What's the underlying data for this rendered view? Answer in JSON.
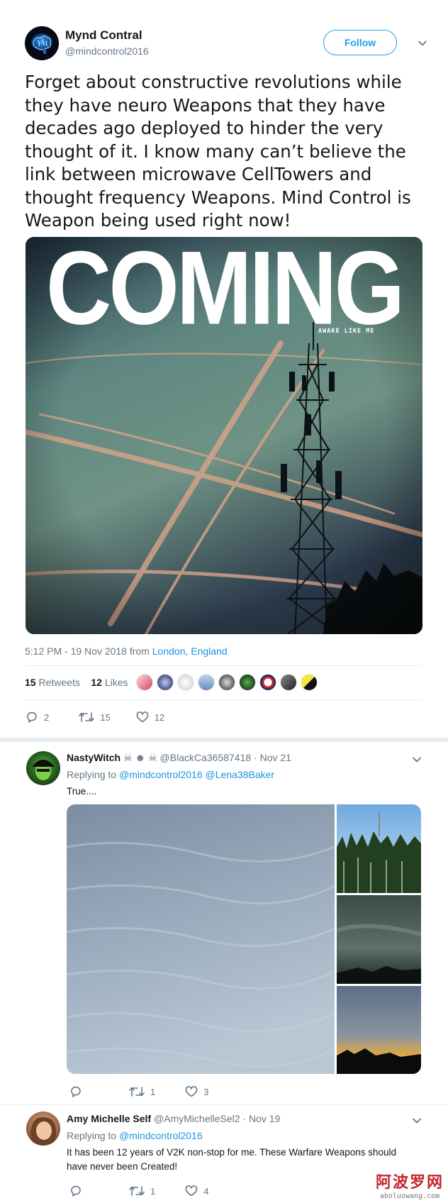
{
  "tweet": {
    "author_name": "Mynd Contral",
    "author_handle": "@mindcontrol2016",
    "follow_label": "Follow",
    "text": "Forget about constructive revolutions while they have neuro Weapons that they have decades ago deployed to hinder the very thought of it. I know many can’t believe the link between microwave CellTowers and thought frequency Weapons. Mind Control is Weapon being used right now!",
    "image_title": "COMING",
    "image_caption": "AWAKE LIKE ME",
    "time": "5:12 PM - 19 Nov 2018 from",
    "location": "London, England",
    "retweets_count": "15",
    "retweets_label": "Retweets",
    "likes_count": "12",
    "likes_label": "Likes",
    "reply_count": "2",
    "retweet_count_action": "15",
    "like_count_action": "12"
  },
  "replies": [
    {
      "name": "NastyWitch",
      "emojis": "☠ ☻ ☠",
      "handle": "@BlackCa36587418",
      "date": "· Nov 21",
      "replying_to_label": "Replying to",
      "replying_to": "@mindcontrol2016 @Lena38Baker",
      "text": "True....",
      "reply_count": "",
      "retweet_count": "1",
      "like_count": "3"
    },
    {
      "name": "Amy Michelle Self",
      "handle": "@AmyMichelleSel2",
      "date": "· Nov 19",
      "replying_to_label": "Replying to",
      "replying_to": "@mindcontrol2016",
      "text": "It has been 12 years of V2K non-stop for me. These Warfare Weapons should have never been Created!",
      "reply_count": "",
      "retweet_count": "1",
      "like_count": "4"
    }
  ],
  "watermark": {
    "cn": "阿波罗网",
    "en": "aboluowang.com"
  },
  "colors": {
    "accent": "#1da1f2",
    "link": "#1b95e0",
    "muted": "#657786",
    "text": "#14171a",
    "divider": "#e6ecf0"
  },
  "icons": [
    "brain-icon",
    "chevron-down-icon",
    "reply-icon",
    "retweet-icon",
    "heart-icon"
  ]
}
